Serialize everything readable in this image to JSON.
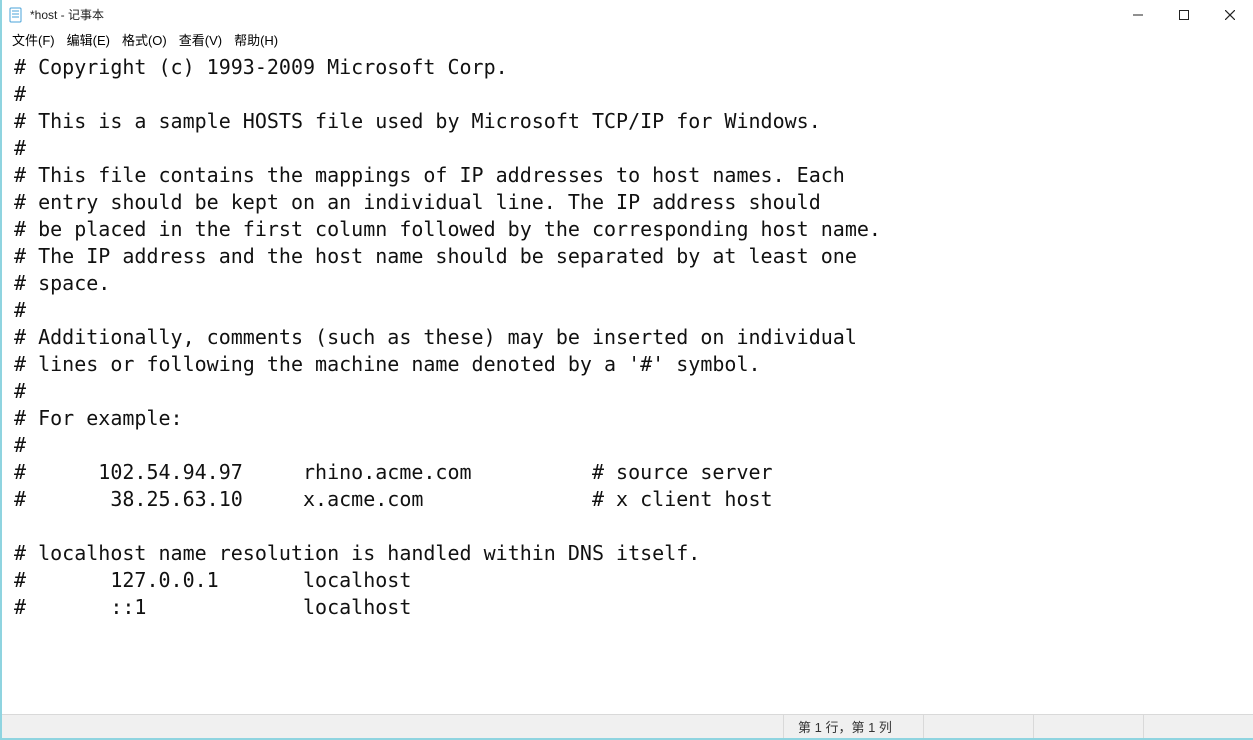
{
  "window": {
    "title": "*host - 记事本"
  },
  "menu": {
    "file": "文件(F)",
    "edit": "编辑(E)",
    "format": "格式(O)",
    "view": "查看(V)",
    "help": "帮助(H)"
  },
  "editor": {
    "content": "# Copyright (c) 1993-2009 Microsoft Corp.\n#\n# This is a sample HOSTS file used by Microsoft TCP/IP for Windows.\n#\n# This file contains the mappings of IP addresses to host names. Each\n# entry should be kept on an individual line. The IP address should\n# be placed in the first column followed by the corresponding host name.\n# The IP address and the host name should be separated by at least one\n# space.\n#\n# Additionally, comments (such as these) may be inserted on individual\n# lines or following the machine name denoted by a '#' symbol.\n#\n# For example:\n#\n#      102.54.94.97     rhino.acme.com          # source server\n#       38.25.63.10     x.acme.com              # x client host\n\n# localhost name resolution is handled within DNS itself.\n#\t127.0.0.1       localhost\n#\t::1             localhost"
  },
  "status": {
    "position": "第 1 行，第 1 列"
  }
}
